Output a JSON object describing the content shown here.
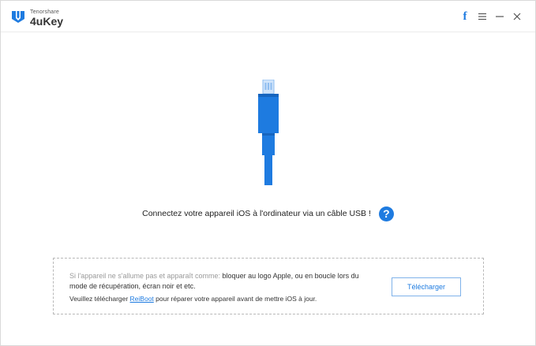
{
  "app": {
    "vendor": "Tenorshare",
    "name": "4uKey",
    "accent": "#1e7be0"
  },
  "window_controls": {
    "facebook_icon": "facebook-icon",
    "menu_icon": "menu-icon",
    "minimize_icon": "minimize-icon",
    "close_icon": "close-icon"
  },
  "main": {
    "instruction": "Connectez votre appareil iOS à l'ordinateur via un câble USB !",
    "help_icon": "?"
  },
  "info": {
    "prefix": "Si l'appareil ne s'allume pas et apparaît comme:",
    "states": " bloquer au logo Apple, ou en boucle lors du mode de récupération, écran noir et etc.",
    "line2_before": "Veuillez télécharger ",
    "reiboot": "ReiBoot",
    "line2_after": " pour réparer votre appareil avant de mettre iOS à jour.",
    "download_label": "Télécharger"
  }
}
